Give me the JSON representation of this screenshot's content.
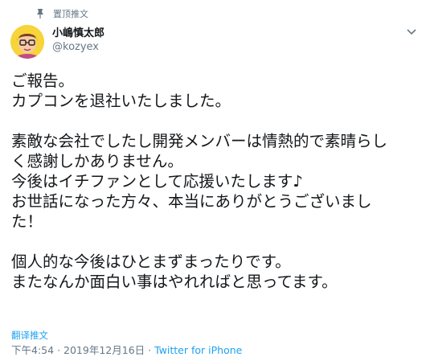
{
  "pinned_label": "置顶推文",
  "user": {
    "display_name": "小嶋慎太郎",
    "handle": "@kozyex"
  },
  "tweet_lines": [
    "ご報告。",
    "カプコンを退社いたしました。",
    "",
    "素敵な会社でしたし開発メンバーは情熱的で素晴らし",
    "く感謝しかありません。",
    "今後はイチファンとして応援いたします♪",
    "お世話になった方々、本当にありがとうございまし",
    "た！",
    "",
    "個人的な今後はひとまずまったりです。",
    "またなんか面白い事はやれればと思ってます。"
  ],
  "translate_label": "翻译推文",
  "meta": {
    "time": "下午4:54",
    "separator": "·",
    "date": "2019年12月16日",
    "source": "Twitter for iPhone"
  },
  "colors": {
    "accent": "#1da1f2",
    "muted": "#657786",
    "text": "#14171a"
  },
  "icons": {
    "pin": "pin-icon",
    "caret": "chevron-down-icon"
  }
}
